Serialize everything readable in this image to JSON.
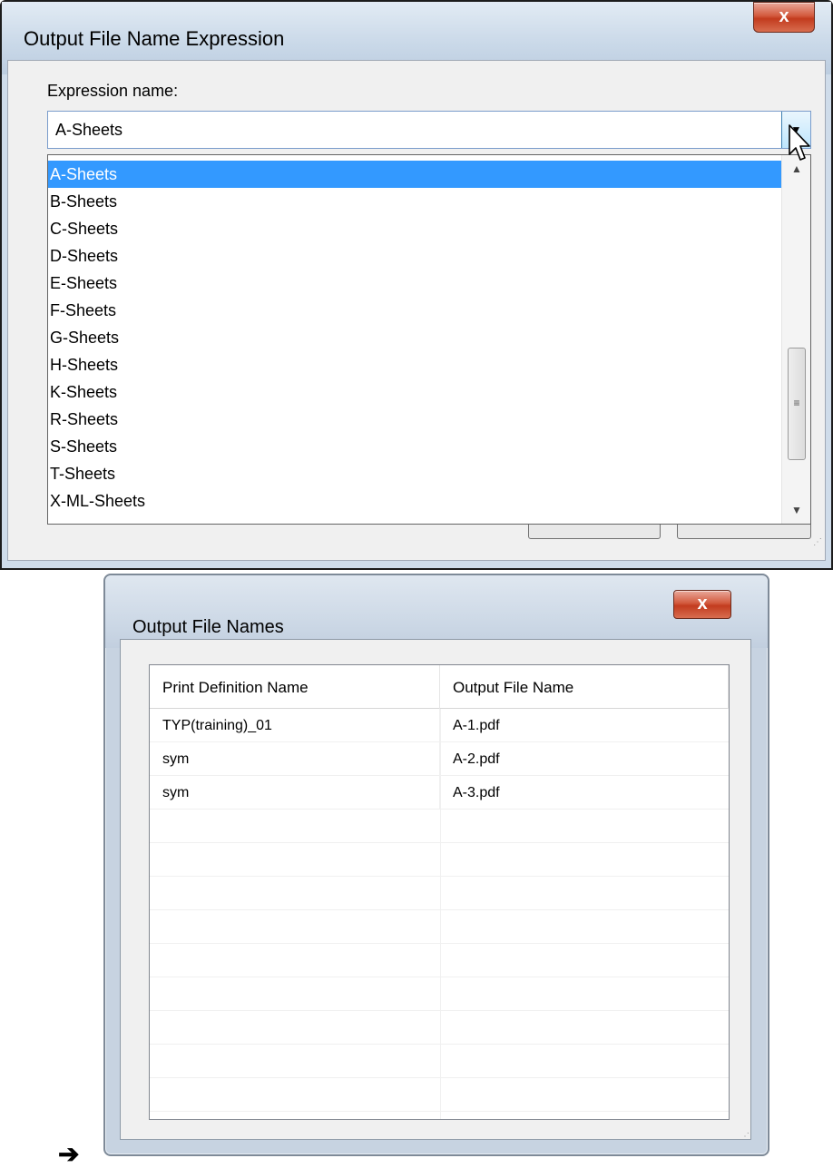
{
  "dialog1": {
    "title": "Output File Name Expression",
    "close_label": "x",
    "expression_label": "Expression name:",
    "combo_value": "A-Sheets",
    "dropdown_items": [
      {
        "label": "A-Sheets",
        "selected": true
      },
      {
        "label": "B-Sheets",
        "selected": false
      },
      {
        "label": "C-Sheets",
        "selected": false
      },
      {
        "label": "D-Sheets",
        "selected": false
      },
      {
        "label": "E-Sheets",
        "selected": false
      },
      {
        "label": "F-Sheets",
        "selected": false
      },
      {
        "label": "G-Sheets",
        "selected": false
      },
      {
        "label": "H-Sheets",
        "selected": false
      },
      {
        "label": "K-Sheets",
        "selected": false
      },
      {
        "label": "R-Sheets",
        "selected": false
      },
      {
        "label": "S-Sheets",
        "selected": false
      },
      {
        "label": "T-Sheets",
        "selected": false
      },
      {
        "label": "X-ML-Sheets",
        "selected": false
      }
    ]
  },
  "dialog2": {
    "title": "Output File Names",
    "close_label": "x",
    "columns": [
      "Print Definition Name",
      "Output File Name"
    ],
    "rows": [
      [
        "TYP(training)_01",
        "A-1.pdf"
      ],
      [
        "sym",
        "A-2.pdf"
      ],
      [
        "sym",
        "A-3.pdf"
      ]
    ],
    "empty_rows": 11
  },
  "arrow_glyph": "➔",
  "colors": {
    "selection": "#3399ff",
    "close_button": "#c94a2e",
    "title_bar": "#c9d8e8"
  }
}
